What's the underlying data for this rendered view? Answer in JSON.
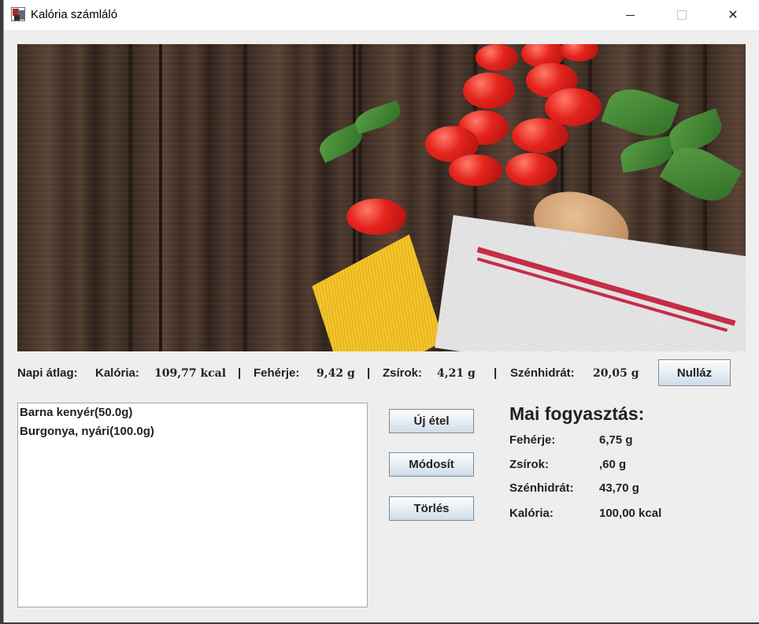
{
  "window": {
    "title": "Kalória számláló",
    "controls": {
      "minimize": "minimize",
      "maximize": "maximize",
      "close": "✕"
    }
  },
  "banner": {
    "description_icon": "food-banner-image"
  },
  "daily_average": {
    "label": "Napi átlag:",
    "calorie_label": "Kalória:",
    "calorie_value": "109,77 kcal",
    "protein_label": "Fehérje:",
    "protein_value": "9,42 g",
    "fat_label": "Zsírok:",
    "fat_value": "4,21 g",
    "carb_label": "Szénhidrát:",
    "carb_value": "20,05 g",
    "separator": "|",
    "reset_button": "Nulláz"
  },
  "food_list": {
    "items": [
      "Barna kenyér(50.0g)",
      "Burgonya, nyári(100.0g)"
    ]
  },
  "actions": {
    "new_food": "Új étel",
    "modify": "Módosít",
    "delete": "Törlés"
  },
  "today": {
    "title": "Mai fogyasztás:",
    "rows": [
      {
        "label": "Fehérje:",
        "value": "6,75 g"
      },
      {
        "label": "Zsírok:",
        "value": ",60 g"
      },
      {
        "label": "Szénhidrát:",
        "value": "43,70 g"
      },
      {
        "label": "Kalória:",
        "value": "100,00 kcal"
      }
    ]
  }
}
